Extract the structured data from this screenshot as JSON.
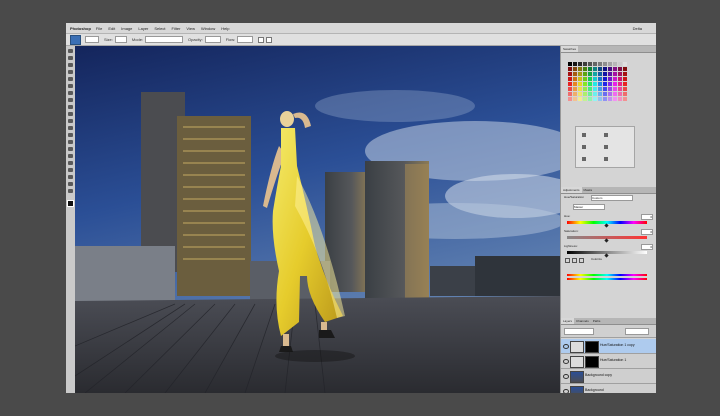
{
  "app": {
    "name": "Photoshop",
    "menus": [
      "File",
      "Edit",
      "Image",
      "Layer",
      "Select",
      "Filter",
      "View",
      "Window",
      "Help"
    ],
    "user": "Delta"
  },
  "options_bar": {
    "size_label": "Size:",
    "mode_label": "Mode:",
    "opacity_label": "Opacity:",
    "flow_label": "Flow:",
    "icons": [
      "brush-icon",
      "brush-preset-icon",
      "airbrush-icon",
      "pressure-icon"
    ]
  },
  "panels": {
    "swatches_tab": "Swatches",
    "adjustments_tab": "Adjustments",
    "masks_tab": "Masks",
    "layers_tab": "Layers",
    "channels_tab": "Channels",
    "paths_tab": "Paths",
    "hue_sat": {
      "title": "Hue/Saturation",
      "preset_label": "Custom",
      "channel": "Master",
      "hue_label": "Hue:",
      "hue_value": "0",
      "saturation_label": "Saturation:",
      "saturation_value": "0",
      "lightness_label": "Lightness:",
      "lightness_value": "0",
      "colorize_label": "Colorize"
    },
    "layers": [
      {
        "name": "Hue/Saturation 1 copy",
        "selected": true
      },
      {
        "name": "Hue/Saturation 1",
        "selected": false
      },
      {
        "name": "Background copy",
        "selected": false
      },
      {
        "name": "Background",
        "selected": false
      }
    ]
  },
  "colors": {
    "accent": "#3a6fb5",
    "selected_layer": "#aecbee"
  }
}
